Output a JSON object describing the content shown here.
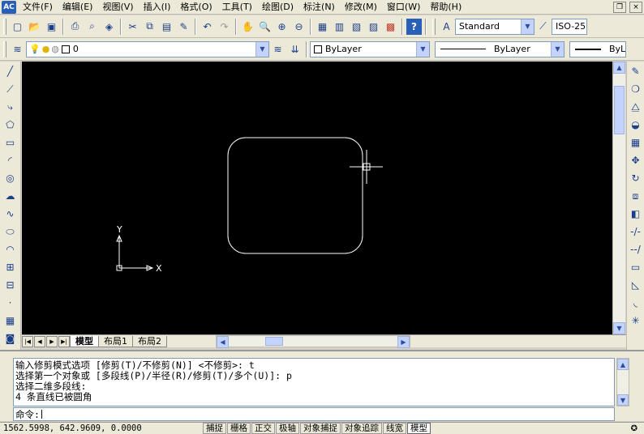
{
  "app": {
    "icon_label": "AC"
  },
  "menu": [
    {
      "label": "文件(F)",
      "name": "file"
    },
    {
      "label": "编辑(E)",
      "name": "edit"
    },
    {
      "label": "视图(V)",
      "name": "view"
    },
    {
      "label": "插入(I)",
      "name": "insert"
    },
    {
      "label": "格式(O)",
      "name": "format"
    },
    {
      "label": "工具(T)",
      "name": "tools"
    },
    {
      "label": "绘图(D)",
      "name": "draw"
    },
    {
      "label": "标注(N)",
      "name": "dimension"
    },
    {
      "label": "修改(M)",
      "name": "modify"
    },
    {
      "label": "窗口(W)",
      "name": "window"
    },
    {
      "label": "帮助(H)",
      "name": "help"
    }
  ],
  "window_controls": {
    "restore": "❐",
    "close": "×"
  },
  "toolbar1": {
    "text_style": "Standard",
    "dim_style": "ISO-25"
  },
  "toolbar2": {
    "layer": "0",
    "color": "ByLayer",
    "linetype": "ByLayer",
    "lineweight": "ByLay"
  },
  "canvas": {
    "ucs_x_label": "X",
    "ucs_y_label": "Y"
  },
  "tabs": [
    {
      "label": "模型",
      "active": true
    },
    {
      "label": "布局1",
      "active": false
    },
    {
      "label": "布局2",
      "active": false
    }
  ],
  "command": {
    "history": [
      "输入修剪模式选项 [修剪(T)/不修剪(N)] <不修剪>: t",
      "选择第一个对象或 [多段线(P)/半径(R)/修剪(T)/多个(U)]: p",
      "选择二维多段线:",
      "4 条直线已被圆角"
    ],
    "prompt": "命令:"
  },
  "status": {
    "coords": "1562.5998, 642.9609, 0.0000",
    "toggles": [
      {
        "label": "捕捉",
        "on": false
      },
      {
        "label": "栅格",
        "on": false
      },
      {
        "label": "正交",
        "on": false
      },
      {
        "label": "极轴",
        "on": false
      },
      {
        "label": "对象捕捉",
        "on": false
      },
      {
        "label": "对象追踪",
        "on": false
      },
      {
        "label": "线宽",
        "on": false
      },
      {
        "label": "模型",
        "on": true
      }
    ]
  },
  "colors": {
    "canvas_bg": "#000000",
    "entity": "#ffffff",
    "ui_bg": "#ece9d8"
  }
}
